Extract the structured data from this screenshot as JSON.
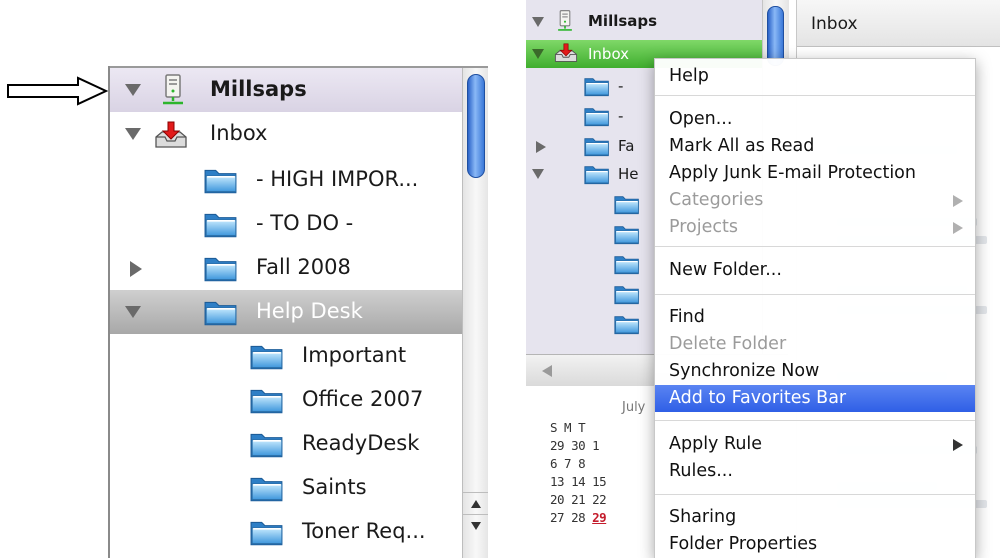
{
  "left": {
    "account": "Millsaps",
    "inbox": "Inbox",
    "folders": [
      "- HIGH IMPOR...",
      "- TO DO -",
      "Fall 2008",
      "Help Desk"
    ],
    "subfolders": [
      "Important",
      "Office 2007",
      "ReadyDesk",
      "Saints",
      "Toner Req..."
    ]
  },
  "right": {
    "account": "Millsaps",
    "inbox": "Inbox",
    "list_title": "Inbox",
    "tree_partial": [
      "- ",
      "- ",
      "Fa",
      "He"
    ],
    "calendar": {
      "month": "July",
      "weekdays": "S  M  T",
      "rows": [
        "29 30  1",
        " 6  7  8",
        "13 14 15",
        "20 21 22",
        "27 28 "
      ],
      "today": "29"
    },
    "menu": {
      "help": "Help",
      "open": "Open...",
      "mark_all_read": "Mark All as Read",
      "junk": "Apply Junk E-mail Protection",
      "categories": "Categories",
      "projects": "Projects",
      "new_folder": "New Folder...",
      "find": "Find",
      "delete_folder": "Delete Folder",
      "sync": "Synchronize Now",
      "add_favorites": "Add to Favorites Bar",
      "apply_rule": "Apply Rule",
      "rules": "Rules...",
      "sharing": "Sharing",
      "folder_properties": "Folder Properties"
    }
  },
  "colors": {
    "highlight": "#3a6cf0",
    "green_selection": "#4cbb39",
    "folder_blue": "#5aa9e6"
  }
}
